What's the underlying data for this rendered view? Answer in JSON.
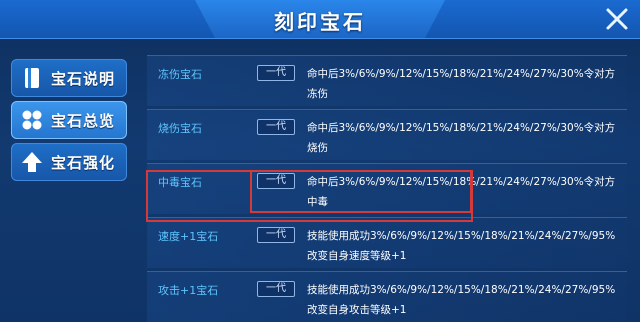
{
  "header": {
    "title": "刻印宝石",
    "close_icon": "close-icon"
  },
  "sidebar": {
    "items": [
      {
        "label": "宝石说明",
        "icon": "book-icon",
        "active": false
      },
      {
        "label": "宝石总览",
        "icon": "grid-icon",
        "active": true
      },
      {
        "label": "宝石强化",
        "icon": "up-arrow-icon",
        "active": false
      }
    ]
  },
  "gems": [
    {
      "name": "冻伤宝石",
      "generation": "一代",
      "description": "命中后3%/6%/9%/12%/15%/18%/21%/24%/27%/30%令对方冻伤"
    },
    {
      "name": "烧伤宝石",
      "generation": "一代",
      "description": "命中后3%/6%/9%/12%/15%/18%/21%/24%/27%/30%令对方烧伤"
    },
    {
      "name": "中毒宝石",
      "generation": "一代",
      "description": "命中后3%/6%/9%/12%/15%/18%/21%/24%/27%/30%令对方中毒"
    },
    {
      "name": "速度+1宝石",
      "generation": "一代",
      "description": "技能使用成功3%/6%/9%/12%/15%/18%/21%/24%/27%/95%改变自身速度等级+1"
    },
    {
      "name": "攻击+1宝石",
      "generation": "一代",
      "description": "技能使用成功3%/6%/9%/12%/15%/18%/21%/24%/27%/95%改变自身攻击等级+1"
    }
  ],
  "colors": {
    "accent": "#5fc6ff",
    "highlight": "#d33a3a",
    "panel": "#123a70"
  }
}
